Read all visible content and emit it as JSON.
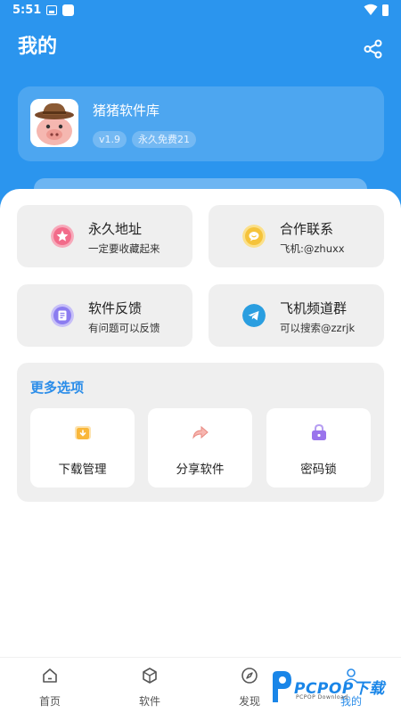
{
  "status_bar": {
    "time": "5:51"
  },
  "header": {
    "title": "我的"
  },
  "app_card": {
    "name": "猪猪软件库",
    "version": "v1.9",
    "license": "永久免费21"
  },
  "tiles": [
    {
      "title": "永久地址",
      "subtitle": "一定要收藏起来",
      "icon": "star-icon",
      "color": "#f26b8a"
    },
    {
      "title": "合作联系",
      "subtitle": "飞机:@zhuxx",
      "icon": "chat-icon",
      "color": "#f5c33b"
    },
    {
      "title": "软件反馈",
      "subtitle": "有问题可以反馈",
      "icon": "feedback-icon",
      "color": "#8b7cf0"
    },
    {
      "title": "飞机频道群",
      "subtitle": "可以搜索@zzrjk",
      "icon": "telegram-icon",
      "color": "#2a9ee0"
    }
  ],
  "more": {
    "title": "更多选项",
    "options": [
      {
        "label": "下载管理",
        "icon": "download-folder-icon"
      },
      {
        "label": "分享软件",
        "icon": "share-arrow-icon"
      },
      {
        "label": "密码锁",
        "icon": "lock-icon"
      }
    ]
  },
  "nav": {
    "items": [
      {
        "label": "首页",
        "icon": "home-icon"
      },
      {
        "label": "软件",
        "icon": "cube-icon"
      },
      {
        "label": "发现",
        "icon": "compass-icon"
      },
      {
        "label": "我的",
        "icon": "profile-icon",
        "active": true
      }
    ]
  },
  "watermark": {
    "brand": "PCPOP下载",
    "sub": "PCPOP Download"
  },
  "colors": {
    "primary": "#2b95ee",
    "accent": "#2b8de9",
    "tile_bg": "#efefef"
  }
}
